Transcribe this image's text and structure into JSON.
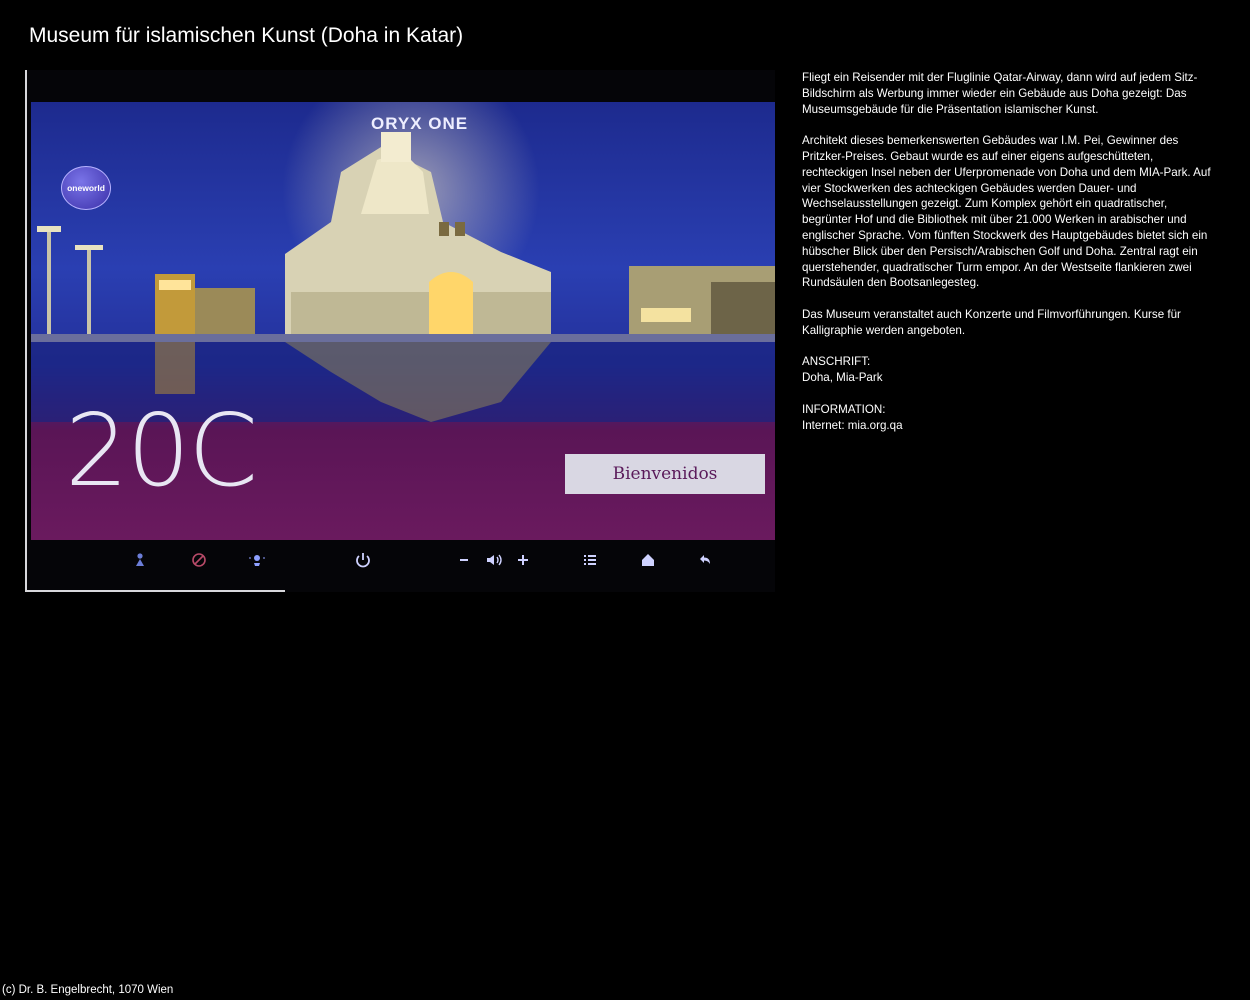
{
  "page_title": "Museum für islamischen Kunst (Doha in Katar)",
  "screen": {
    "brand": "ORYX ONE",
    "alliance_badge": "oneworld",
    "seat": "20C",
    "welcome_label": "Bienvenidos",
    "colors": {
      "blue": "#2a3fb2",
      "magenta": "#6a1a5e"
    }
  },
  "controls": [
    "person-icon",
    "no-attendant-icon",
    "reading-light-icon",
    "power-icon",
    "volume-down-icon",
    "volume-icon",
    "volume-up-icon",
    "menu-icon",
    "home-icon",
    "back-icon"
  ],
  "description": {
    "paragraph1": "Fliegt ein Reisender mit der Fluglinie Qatar-Airway, dann wird auf jedem Sitz-Bildschirm als Werbung immer wieder ein Gebäude aus Doha gezeigt: Das Museumsgebäude für die Präsentation islamischer Kunst.",
    "paragraph2": "Architekt dieses bemerkenswerten Gebäudes war I.M. Pei, Gewinner des Pritzker-Preises. Gebaut wurde es auf einer eigens aufgeschütteten, rechteckigen Insel neben der Uferpromenade von Doha und dem MIA-Park. Auf vier Stockwerken des achteckigen Gebäudes werden Dauer- und Wechselausstellungen gezeigt. Zum Komplex gehört ein quadratischer, begrünter Hof und die Bibliothek mit über 21.000 Werken in arabischer und englischer Sprache. Vom fünften Stockwerk des Hauptgebäudes bietet sich ein hübscher Blick über den Persisch/Arabischen Golf und Doha. Zentral ragt ein querstehender, quadratischer Turm empor. An der Westseite flankieren zwei Rundsäulen den Bootsanlegesteg.",
    "paragraph3": "Das Museum veranstaltet auch Konzerte und Filmvorführungen. Kurse für Kalligraphie werden angeboten.",
    "address_label": "ANSCHRIFT:",
    "address": "Doha, Mia-Park",
    "info_label": "INFORMATION:",
    "info": "Internet: mia.org.qa"
  },
  "footer": "(c) Dr. B. Engelbrecht, 1070 Wien"
}
